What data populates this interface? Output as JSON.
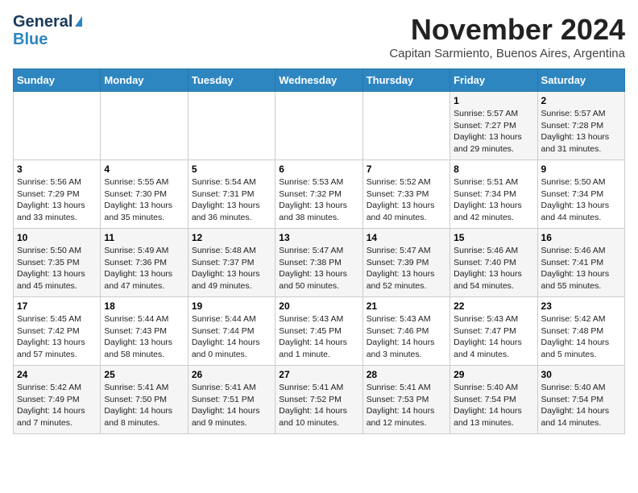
{
  "header": {
    "logo_line1": "General",
    "logo_line2": "Blue",
    "month": "November 2024",
    "location": "Capitan Sarmiento, Buenos Aires, Argentina"
  },
  "days_of_week": [
    "Sunday",
    "Monday",
    "Tuesday",
    "Wednesday",
    "Thursday",
    "Friday",
    "Saturday"
  ],
  "weeks": [
    [
      {
        "day": "",
        "info": ""
      },
      {
        "day": "",
        "info": ""
      },
      {
        "day": "",
        "info": ""
      },
      {
        "day": "",
        "info": ""
      },
      {
        "day": "",
        "info": ""
      },
      {
        "day": "1",
        "info": "Sunrise: 5:57 AM\nSunset: 7:27 PM\nDaylight: 13 hours\nand 29 minutes."
      },
      {
        "day": "2",
        "info": "Sunrise: 5:57 AM\nSunset: 7:28 PM\nDaylight: 13 hours\nand 31 minutes."
      }
    ],
    [
      {
        "day": "3",
        "info": "Sunrise: 5:56 AM\nSunset: 7:29 PM\nDaylight: 13 hours\nand 33 minutes."
      },
      {
        "day": "4",
        "info": "Sunrise: 5:55 AM\nSunset: 7:30 PM\nDaylight: 13 hours\nand 35 minutes."
      },
      {
        "day": "5",
        "info": "Sunrise: 5:54 AM\nSunset: 7:31 PM\nDaylight: 13 hours\nand 36 minutes."
      },
      {
        "day": "6",
        "info": "Sunrise: 5:53 AM\nSunset: 7:32 PM\nDaylight: 13 hours\nand 38 minutes."
      },
      {
        "day": "7",
        "info": "Sunrise: 5:52 AM\nSunset: 7:33 PM\nDaylight: 13 hours\nand 40 minutes."
      },
      {
        "day": "8",
        "info": "Sunrise: 5:51 AM\nSunset: 7:34 PM\nDaylight: 13 hours\nand 42 minutes."
      },
      {
        "day": "9",
        "info": "Sunrise: 5:50 AM\nSunset: 7:34 PM\nDaylight: 13 hours\nand 44 minutes."
      }
    ],
    [
      {
        "day": "10",
        "info": "Sunrise: 5:50 AM\nSunset: 7:35 PM\nDaylight: 13 hours\nand 45 minutes."
      },
      {
        "day": "11",
        "info": "Sunrise: 5:49 AM\nSunset: 7:36 PM\nDaylight: 13 hours\nand 47 minutes."
      },
      {
        "day": "12",
        "info": "Sunrise: 5:48 AM\nSunset: 7:37 PM\nDaylight: 13 hours\nand 49 minutes."
      },
      {
        "day": "13",
        "info": "Sunrise: 5:47 AM\nSunset: 7:38 PM\nDaylight: 13 hours\nand 50 minutes."
      },
      {
        "day": "14",
        "info": "Sunrise: 5:47 AM\nSunset: 7:39 PM\nDaylight: 13 hours\nand 52 minutes."
      },
      {
        "day": "15",
        "info": "Sunrise: 5:46 AM\nSunset: 7:40 PM\nDaylight: 13 hours\nand 54 minutes."
      },
      {
        "day": "16",
        "info": "Sunrise: 5:46 AM\nSunset: 7:41 PM\nDaylight: 13 hours\nand 55 minutes."
      }
    ],
    [
      {
        "day": "17",
        "info": "Sunrise: 5:45 AM\nSunset: 7:42 PM\nDaylight: 13 hours\nand 57 minutes."
      },
      {
        "day": "18",
        "info": "Sunrise: 5:44 AM\nSunset: 7:43 PM\nDaylight: 13 hours\nand 58 minutes."
      },
      {
        "day": "19",
        "info": "Sunrise: 5:44 AM\nSunset: 7:44 PM\nDaylight: 14 hours\nand 0 minutes."
      },
      {
        "day": "20",
        "info": "Sunrise: 5:43 AM\nSunset: 7:45 PM\nDaylight: 14 hours\nand 1 minute."
      },
      {
        "day": "21",
        "info": "Sunrise: 5:43 AM\nSunset: 7:46 PM\nDaylight: 14 hours\nand 3 minutes."
      },
      {
        "day": "22",
        "info": "Sunrise: 5:43 AM\nSunset: 7:47 PM\nDaylight: 14 hours\nand 4 minutes."
      },
      {
        "day": "23",
        "info": "Sunrise: 5:42 AM\nSunset: 7:48 PM\nDaylight: 14 hours\nand 5 minutes."
      }
    ],
    [
      {
        "day": "24",
        "info": "Sunrise: 5:42 AM\nSunset: 7:49 PM\nDaylight: 14 hours\nand 7 minutes."
      },
      {
        "day": "25",
        "info": "Sunrise: 5:41 AM\nSunset: 7:50 PM\nDaylight: 14 hours\nand 8 minutes."
      },
      {
        "day": "26",
        "info": "Sunrise: 5:41 AM\nSunset: 7:51 PM\nDaylight: 14 hours\nand 9 minutes."
      },
      {
        "day": "27",
        "info": "Sunrise: 5:41 AM\nSunset: 7:52 PM\nDaylight: 14 hours\nand 10 minutes."
      },
      {
        "day": "28",
        "info": "Sunrise: 5:41 AM\nSunset: 7:53 PM\nDaylight: 14 hours\nand 12 minutes."
      },
      {
        "day": "29",
        "info": "Sunrise: 5:40 AM\nSunset: 7:54 PM\nDaylight: 14 hours\nand 13 minutes."
      },
      {
        "day": "30",
        "info": "Sunrise: 5:40 AM\nSunset: 7:54 PM\nDaylight: 14 hours\nand 14 minutes."
      }
    ]
  ]
}
